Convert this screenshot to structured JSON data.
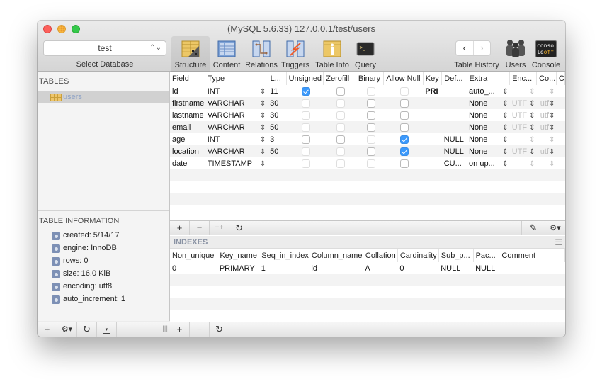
{
  "window": {
    "title": "(MySQL 5.6.33) 127.0.0.1/test/users"
  },
  "toolbar": {
    "database_select": {
      "value": "test",
      "label": "Select Database"
    },
    "buttons": [
      {
        "label": "Structure",
        "icon": "structure-icon",
        "active": true
      },
      {
        "label": "Content",
        "icon": "content-icon"
      },
      {
        "label": "Relations",
        "icon": "relations-icon"
      },
      {
        "label": "Triggers",
        "icon": "triggers-icon"
      },
      {
        "label": "Table Info",
        "icon": "table-info-icon"
      },
      {
        "label": "Query",
        "icon": "query-icon"
      }
    ],
    "history": {
      "label": "Table History",
      "back": "‹",
      "forward": "›"
    },
    "users": {
      "label": "Users"
    },
    "console": {
      "label": "Console",
      "icon_text_top": "conso",
      "icon_text_bottom_1": "le",
      "icon_text_bottom_2": "off"
    }
  },
  "sidebar": {
    "tables_header": "TABLES",
    "tables": [
      {
        "name": "users",
        "selected": true
      }
    ],
    "info_header": "TABLE INFORMATION",
    "info": [
      "created: 5/14/17",
      "engine: InnoDB",
      "rows: 0",
      "size: 16.0 KiB",
      "encoding: utf8",
      "auto_increment: 1"
    ],
    "bottom_bar": {
      "add": "+",
      "gear": "⚙▾",
      "refresh": "↻",
      "filter": "▾",
      "resize": "|||"
    }
  },
  "structure": {
    "columns": [
      "Field",
      "Type",
      "",
      "L...",
      "Unsigned",
      "Zerofill",
      "Binary",
      "Allow Null",
      "Key",
      "Def...",
      "Extra",
      "",
      "Enc...",
      "Co...",
      "C"
    ],
    "rows": [
      {
        "field": "id",
        "type": "INT",
        "length": "11",
        "unsigned": true,
        "zerofill": false,
        "binary": false,
        "allow_null": false,
        "key": "PRI",
        "default": "",
        "extra": "auto_...",
        "encoding": "",
        "collation": "",
        "text_enabled": false
      },
      {
        "field": "firstname",
        "type": "VARCHAR",
        "length": "30",
        "unsigned": false,
        "zerofill": false,
        "binary": false,
        "allow_null": false,
        "key": "",
        "default": "",
        "extra": "None",
        "encoding": "UTF",
        "collation": "utf",
        "text_enabled": true
      },
      {
        "field": "lastname",
        "type": "VARCHAR",
        "length": "30",
        "unsigned": false,
        "zerofill": false,
        "binary": false,
        "allow_null": false,
        "key": "",
        "default": "",
        "extra": "None",
        "encoding": "UTF",
        "collation": "utf",
        "text_enabled": true
      },
      {
        "field": "email",
        "type": "VARCHAR",
        "length": "50",
        "unsigned": false,
        "zerofill": false,
        "binary": false,
        "allow_null": false,
        "key": "",
        "default": "",
        "extra": "None",
        "encoding": "UTF",
        "collation": "utf",
        "text_enabled": true
      },
      {
        "field": "age",
        "type": "INT",
        "length": "3",
        "unsigned": false,
        "zerofill": false,
        "binary": false,
        "allow_null": true,
        "key": "",
        "default": "NULL",
        "extra": "None",
        "encoding": "",
        "collation": "",
        "text_enabled": false
      },
      {
        "field": "location",
        "type": "VARCHAR",
        "length": "50",
        "unsigned": false,
        "zerofill": false,
        "binary": false,
        "allow_null": true,
        "key": "",
        "default": "NULL",
        "extra": "None",
        "encoding": "UTF",
        "collation": "utf",
        "text_enabled": true
      },
      {
        "field": "date",
        "type": "TIMESTAMP",
        "length": "",
        "unsigned": false,
        "zerofill": false,
        "binary": false,
        "allow_null": false,
        "key": "",
        "default": "CU...",
        "extra": "on up...",
        "encoding": "",
        "collation": "",
        "text_enabled": false
      }
    ],
    "bottom_bar": {
      "add": "+",
      "remove": "−",
      "duplicate": "++",
      "refresh": "↻",
      "edit": "✎",
      "gear": "⚙▾"
    }
  },
  "indexes": {
    "title": "INDEXES",
    "columns": [
      "Non_unique",
      "Key_name",
      "Seq_in_index",
      "Column_name",
      "Collation",
      "Cardinality",
      "Sub_p...",
      "Pac...",
      "Comment"
    ],
    "rows": [
      [
        "0",
        "PRIMARY",
        "1",
        "id",
        "A",
        "0",
        "NULL",
        "NULL",
        ""
      ]
    ],
    "bottom_bar": {
      "add": "+",
      "remove": "−",
      "refresh": "↻"
    }
  }
}
